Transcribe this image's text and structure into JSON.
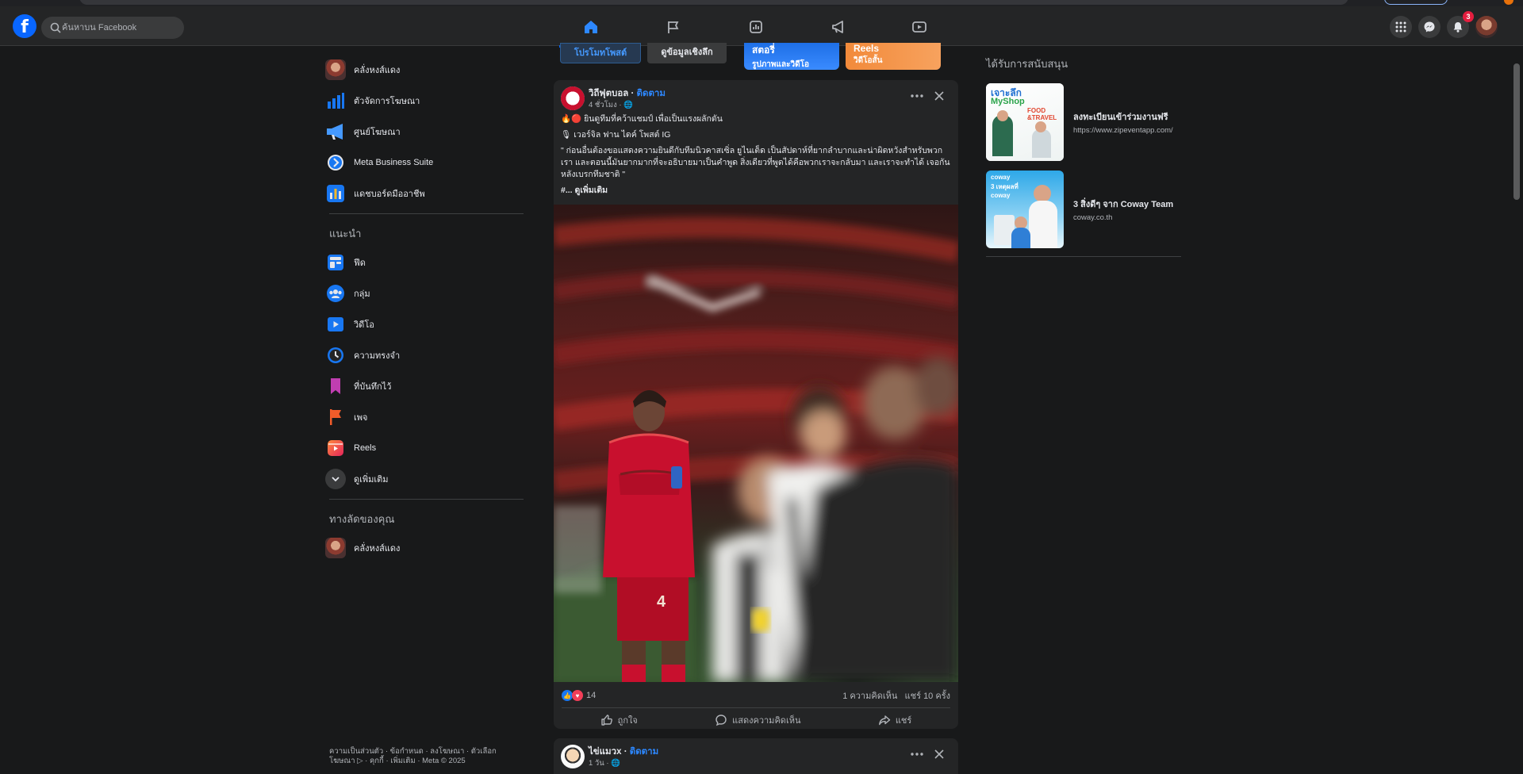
{
  "topbar": {
    "search_placeholder": "ค้นหาบน Facebook",
    "notification_count": "3"
  },
  "left_nav": {
    "profile_name": "คลั่งหงส์แดง",
    "items": [
      {
        "label": "ตัวจัดการโฆษณา"
      },
      {
        "label": "ศูนย์โฆษณา"
      },
      {
        "label": "Meta Business Suite"
      },
      {
        "label": "แดชบอร์ดมืออาชีพ"
      }
    ],
    "suggested_heading": "แนะนำ",
    "suggested": [
      {
        "label": "ฟีด"
      },
      {
        "label": "กลุ่ม"
      },
      {
        "label": "วิดีโอ"
      },
      {
        "label": "ความทรงจำ"
      },
      {
        "label": "ที่บันทึกไว้"
      },
      {
        "label": "เพจ"
      },
      {
        "label": "Reels"
      },
      {
        "label": "ดูเพิ่มเติม"
      }
    ],
    "shortcuts_heading": "ทางลัดของคุณ",
    "shortcut": {
      "label": "คลั่งหงส์แดง"
    },
    "footer": "ความเป็นส่วนตัว · ข้อกำหนด · ลงโฆษณา · ตัวเลือกโฆษณา ▷ · คุกกี้ · เพิ่มเติม · Meta © 2025"
  },
  "stories_strip": {
    "promote_label": "โปรโมทโพสต์",
    "insights_label": "ดูข้อมูลเชิงลึก",
    "story_label": "สตอรี่",
    "story_sub": "รูปภาพและวิดีโอ",
    "reels_label": "Reels",
    "reels_sub": "วิดีโอสั้น"
  },
  "post1": {
    "page_name": "วิถีฟุตบอล",
    "separator": " · ",
    "follow": "ติดตาม",
    "time": "4 ชั่วโมง",
    "line1": "🔥🔴 ยินดูทีมที่คว้าแชมป์ เพื่อเป็นแรงผลักดัน",
    "line2": "🎙 เวอร์จิล ฟาน ไดค์ โพสต์ IG",
    "quote": "\" ก่อนอื่นต้องขอแสดงความยินดีกับทีมนิวคาสเซิ่ล ยูไนเต็ด เป็นสัปดาห์ที่ยากลำบากและน่าผิดหวังสำหรับพวกเรา และตอนนี้มันยากมากที่จะอธิบายมาเป็นคำพูด สิ่งเดียวที่พูดได้คือพวกเราจะกลับมา และเราจะทำได้ เจอกันหลังเบรกทีมชาติ \"",
    "see_more": "#... ดูเพิ่มเติม",
    "reactions_count": "14",
    "comments": "1 ความคิดเห็น",
    "shares": "แชร์ 10 ครั้ง",
    "like_label": "ถูกใจ",
    "comment_label": "แสดงความคิดเห็น",
    "share_label": "แชร์",
    "jersey_number": "4"
  },
  "post2": {
    "page_name": "ไข่แมวx",
    "separator": " · ",
    "follow": "ติดตาม",
    "time": "1 วัน"
  },
  "sponsored": {
    "heading": "ได้รับการสนับสนุน",
    "ads": [
      {
        "title": "ลงทะเบียนเข้าร่วมงานฟรี",
        "url": "https://www.zipeventapp.com/",
        "img_text_1": "เจาะลึก",
        "img_text_2": "MyShop",
        "img_text_3": "FOOD &TRAVEL"
      },
      {
        "title": "3 สิ่งดีๆ จาก Coway Team",
        "url": "coway.co.th",
        "img_text_1": "coway",
        "img_text_2": "3 เหตุผลที่ coway"
      }
    ]
  },
  "colors": {
    "accent": "#0866ff",
    "link": "#2d88ff",
    "bg": "#18191a",
    "card": "#242526",
    "badge": "#e41e3f"
  }
}
